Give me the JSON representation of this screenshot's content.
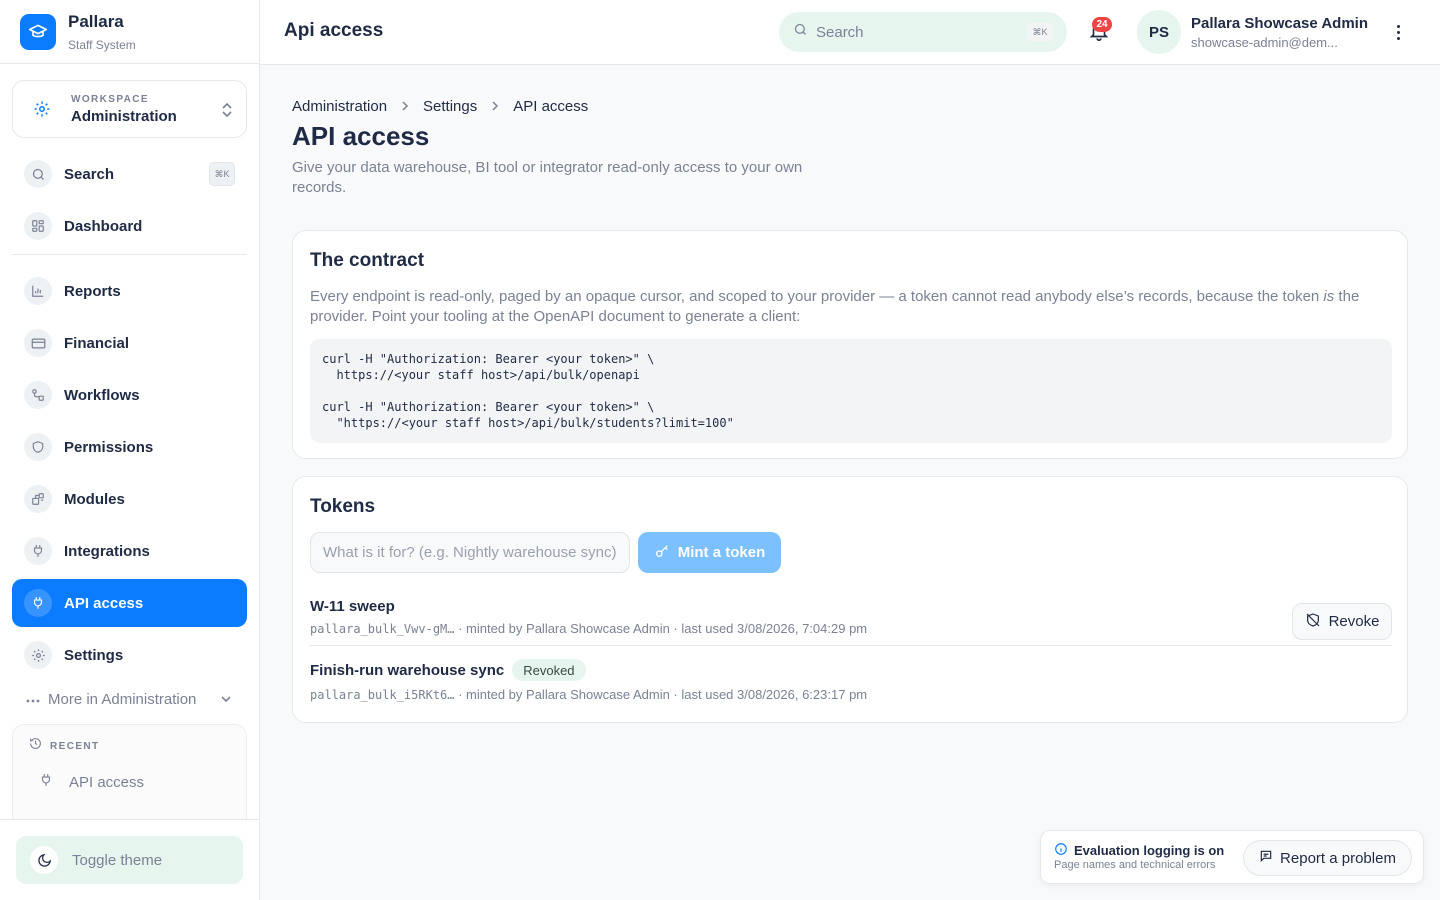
{
  "brand": {
    "name": "Pallara",
    "subtitle": "Staff System"
  },
  "workspace": {
    "label": "WORKSPACE",
    "value": "Administration"
  },
  "sidebar": {
    "search": {
      "label": "Search",
      "shortcut": "⌘K"
    },
    "items": [
      {
        "label": "Dashboard",
        "icon": "dashboard-icon"
      },
      {
        "label": "Reports",
        "icon": "chart-icon"
      },
      {
        "label": "Financial",
        "icon": "card-icon"
      },
      {
        "label": "Workflows",
        "icon": "workflow-icon"
      },
      {
        "label": "Permissions",
        "icon": "shield-icon"
      },
      {
        "label": "Modules",
        "icon": "modules-icon"
      },
      {
        "label": "Integrations",
        "icon": "plug-icon"
      },
      {
        "label": "API access",
        "icon": "plug-icon",
        "active": true
      },
      {
        "label": "Settings",
        "icon": "gear-icon"
      }
    ],
    "more": "More in Administration",
    "recent": {
      "label": "RECENT",
      "items": [
        {
          "label": "API access"
        }
      ]
    },
    "toggle_theme": "Toggle theme"
  },
  "topbar": {
    "title": "Api access",
    "search_placeholder": "Search",
    "search_shortcut": "⌘K",
    "notifications_count": "24",
    "user": {
      "initials": "PS",
      "name": "Pallara Showcase Admin",
      "email": "showcase-admin@dem..."
    }
  },
  "breadcrumb": [
    "Administration",
    "Settings",
    "API access"
  ],
  "page": {
    "title": "API access",
    "subtitle": "Give your data warehouse, BI tool or integrator read-only access to your own records."
  },
  "contract": {
    "title": "The contract",
    "text_before": "Every endpoint is read-only, paged by an opaque cursor, and scoped to your provider — a token cannot read anybody else’s records, because the token ",
    "text_em": "is",
    "text_after": " the provider. Point your tooling at the OpenAPI document to generate a client:",
    "code": "curl -H \"Authorization: Bearer <your token>\" \\\n  https://<your staff host>/api/bulk/openapi\n\ncurl -H \"Authorization: Bearer <your token>\" \\\n  \"https://<your staff host>/api/bulk/students?limit=100\""
  },
  "tokens": {
    "title": "Tokens",
    "input_placeholder": "What is it for? (e.g. Nightly warehouse sync)",
    "mint_label": "Mint a token",
    "revoke_label": "Revoke",
    "revoked_label": "Revoked",
    "rows": [
      {
        "name": "W-11 sweep",
        "prefix": "pallara_bulk_Vwv-gM…",
        "meta": " · minted by Pallara Showcase Admin · last used 3/08/2026, 7:04:29 pm"
      },
      {
        "name": "Finish-run warehouse sync",
        "prefix": "pallara_bulk_i5RKt6…",
        "meta": " · minted by Pallara Showcase Admin · last used 3/08/2026, 6:23:17 pm"
      }
    ]
  },
  "toast": {
    "title": "Evaluation logging is on",
    "subtitle": "Page names and technical errors",
    "button": "Report a problem"
  },
  "colors": {
    "accent": "#0b7cff",
    "mint_button": "#7cc0ff",
    "soft_green": "#e7f5ef",
    "badge_red": "#ef4444"
  }
}
